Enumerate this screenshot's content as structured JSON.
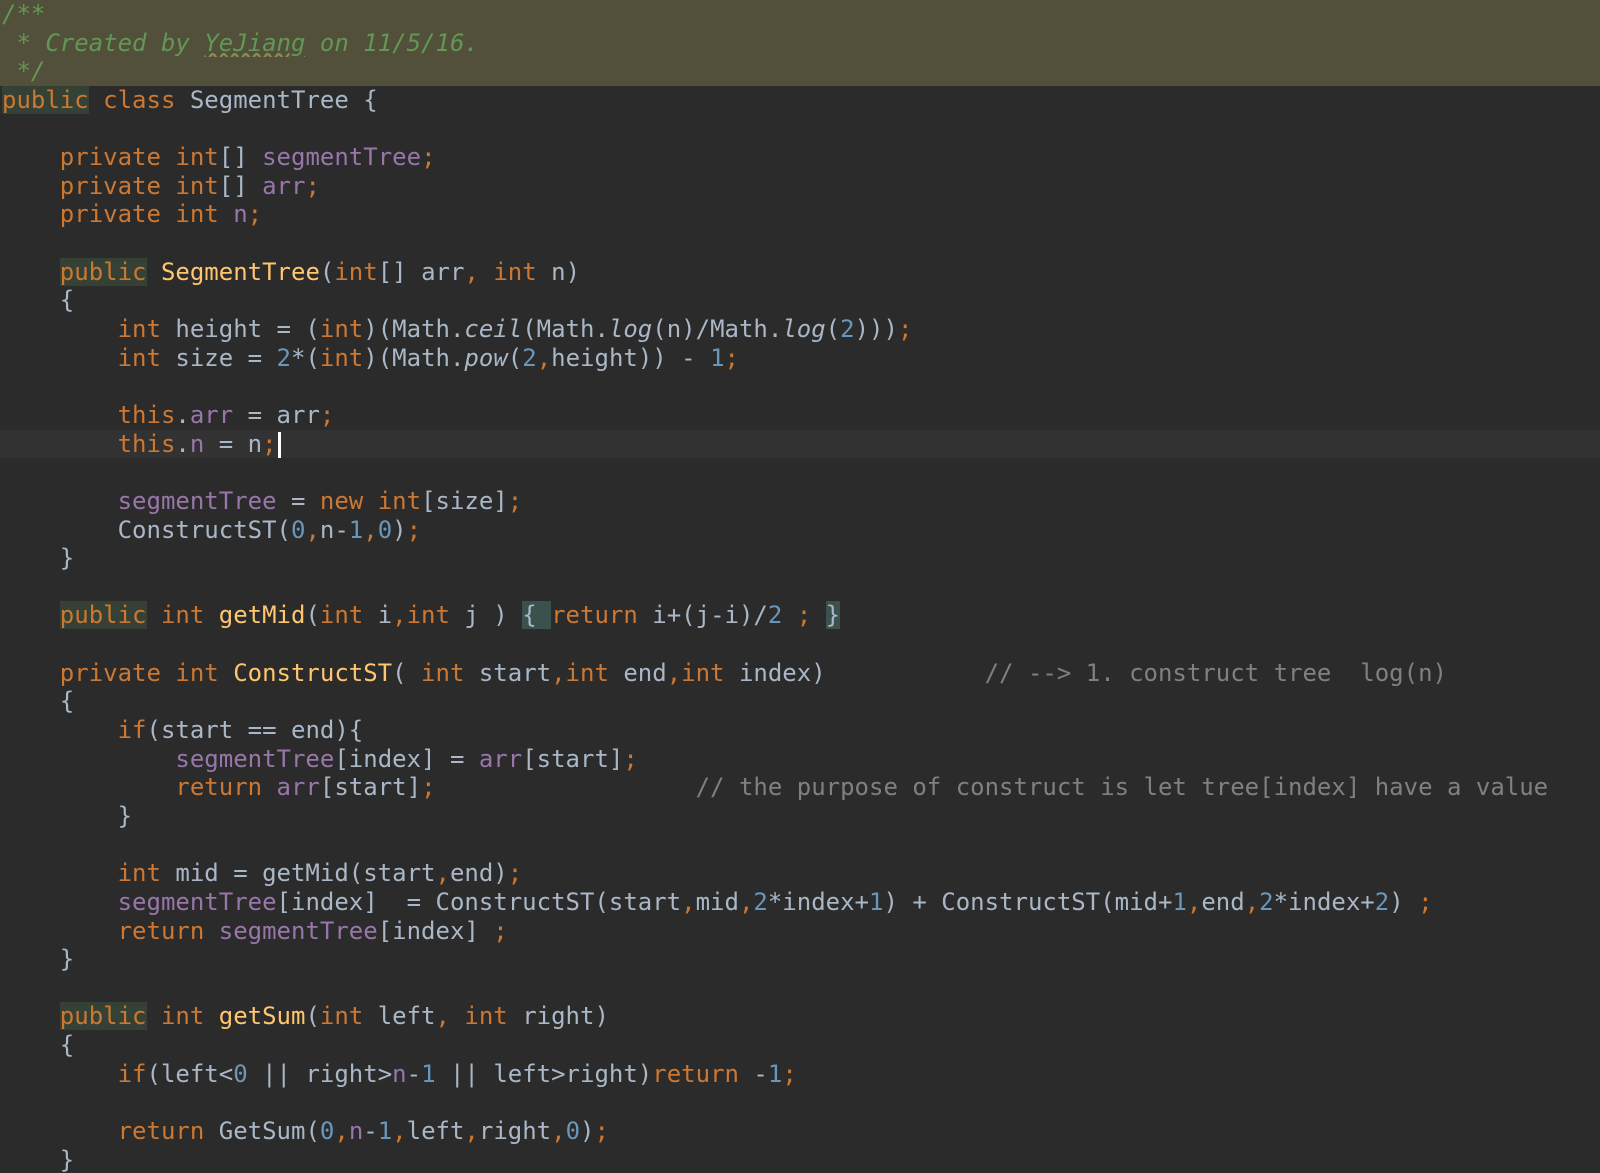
{
  "editor": {
    "file_language": "Java",
    "theme": "dark",
    "colors": {
      "background": "#2b2b2b",
      "doc_header_bg": "#52503a",
      "current_line_bg": "#323232",
      "plain": "#a9b7c6",
      "keyword": "#cc7832",
      "field": "#9876aa",
      "method": "#ffc66d",
      "number": "#6897bb",
      "comment": "#808080",
      "doc_comment": "#629755",
      "caret": "#ffffff"
    },
    "caret_line": 14
  },
  "lines": [
    {
      "class": "doc-header",
      "tokens": [
        {
          "t": "/**",
          "c": "doc_comment",
          "i": true
        }
      ]
    },
    {
      "class": "doc-header",
      "tokens": [
        {
          "t": " * Created by ",
          "c": "doc_comment",
          "i": true
        },
        {
          "t": "YeJiang",
          "c": "doc_comment",
          "i": true,
          "spell": true
        },
        {
          "t": " on 11/5/16.",
          "c": "doc_comment",
          "i": true
        }
      ]
    },
    {
      "class": "doc-header",
      "tokens": [
        {
          "t": " */",
          "c": "doc_comment",
          "i": true
        }
      ]
    },
    {
      "tokens": [
        {
          "t": "public",
          "c": "keyword",
          "usage": true
        },
        {
          "t": " class ",
          "c": "keyword"
        },
        {
          "t": "SegmentTree {",
          "c": "plain"
        }
      ]
    },
    {
      "tokens": []
    },
    {
      "tokens": [
        {
          "t": "    private ",
          "c": "keyword"
        },
        {
          "t": "int",
          "c": "keyword"
        },
        {
          "t": "[] ",
          "c": "plain"
        },
        {
          "t": "segmentTree",
          "c": "field"
        },
        {
          "t": ";",
          "c": "keyword"
        }
      ]
    },
    {
      "tokens": [
        {
          "t": "    private ",
          "c": "keyword"
        },
        {
          "t": "int",
          "c": "keyword"
        },
        {
          "t": "[] ",
          "c": "plain"
        },
        {
          "t": "arr",
          "c": "field"
        },
        {
          "t": ";",
          "c": "keyword"
        }
      ]
    },
    {
      "tokens": [
        {
          "t": "    private ",
          "c": "keyword"
        },
        {
          "t": "int ",
          "c": "keyword"
        },
        {
          "t": "n",
          "c": "field"
        },
        {
          "t": ";",
          "c": "keyword"
        }
      ]
    },
    {
      "tokens": []
    },
    {
      "tokens": [
        {
          "t": "    ",
          "c": "plain"
        },
        {
          "t": "public",
          "c": "keyword",
          "usage": true
        },
        {
          "t": " ",
          "c": "plain"
        },
        {
          "t": "SegmentTree",
          "c": "method"
        },
        {
          "t": "(",
          "c": "plain"
        },
        {
          "t": "int",
          "c": "keyword"
        },
        {
          "t": "[] arr",
          "c": "plain"
        },
        {
          "t": ", ",
          "c": "keyword"
        },
        {
          "t": "int ",
          "c": "keyword"
        },
        {
          "t": "n)",
          "c": "plain"
        }
      ]
    },
    {
      "tokens": [
        {
          "t": "    {",
          "c": "plain"
        }
      ]
    },
    {
      "tokens": [
        {
          "t": "        ",
          "c": "plain"
        },
        {
          "t": "int ",
          "c": "keyword"
        },
        {
          "t": "height = (",
          "c": "plain"
        },
        {
          "t": "int",
          "c": "keyword"
        },
        {
          "t": ")(Math.",
          "c": "plain"
        },
        {
          "t": "ceil",
          "c": "plain",
          "i": true
        },
        {
          "t": "(Math.",
          "c": "plain"
        },
        {
          "t": "log",
          "c": "plain",
          "i": true
        },
        {
          "t": "(n)/Math.",
          "c": "plain"
        },
        {
          "t": "log",
          "c": "plain",
          "i": true
        },
        {
          "t": "(",
          "c": "plain"
        },
        {
          "t": "2",
          "c": "number"
        },
        {
          "t": ")))",
          "c": "plain"
        },
        {
          "t": ";",
          "c": "keyword"
        }
      ]
    },
    {
      "tokens": [
        {
          "t": "        ",
          "c": "plain"
        },
        {
          "t": "int ",
          "c": "keyword"
        },
        {
          "t": "size = ",
          "c": "plain"
        },
        {
          "t": "2",
          "c": "number"
        },
        {
          "t": "*(",
          "c": "plain"
        },
        {
          "t": "int",
          "c": "keyword"
        },
        {
          "t": ")(Math.",
          "c": "plain"
        },
        {
          "t": "pow",
          "c": "plain",
          "i": true
        },
        {
          "t": "(",
          "c": "plain"
        },
        {
          "t": "2",
          "c": "number"
        },
        {
          "t": ",",
          "c": "keyword"
        },
        {
          "t": "height)) - ",
          "c": "plain"
        },
        {
          "t": "1",
          "c": "number"
        },
        {
          "t": ";",
          "c": "keyword"
        }
      ]
    },
    {
      "tokens": []
    },
    {
      "tokens": [
        {
          "t": "        ",
          "c": "plain"
        },
        {
          "t": "this",
          "c": "keyword"
        },
        {
          "t": ".",
          "c": "plain"
        },
        {
          "t": "arr",
          "c": "field"
        },
        {
          "t": " = arr",
          "c": "plain"
        },
        {
          "t": ";",
          "c": "keyword"
        }
      ]
    },
    {
      "class": "current-line",
      "caret": true,
      "tokens": [
        {
          "t": "        ",
          "c": "plain"
        },
        {
          "t": "this",
          "c": "keyword"
        },
        {
          "t": ".",
          "c": "plain"
        },
        {
          "t": "n",
          "c": "field"
        },
        {
          "t": " = n",
          "c": "plain"
        },
        {
          "t": ";",
          "c": "keyword"
        }
      ]
    },
    {
      "tokens": []
    },
    {
      "tokens": [
        {
          "t": "        ",
          "c": "plain"
        },
        {
          "t": "segmentTree",
          "c": "field"
        },
        {
          "t": " = ",
          "c": "plain"
        },
        {
          "t": "new ",
          "c": "keyword"
        },
        {
          "t": "int",
          "c": "keyword"
        },
        {
          "t": "[size]",
          "c": "plain"
        },
        {
          "t": ";",
          "c": "keyword"
        }
      ]
    },
    {
      "tokens": [
        {
          "t": "        ConstructST(",
          "c": "plain"
        },
        {
          "t": "0",
          "c": "number"
        },
        {
          "t": ",",
          "c": "keyword"
        },
        {
          "t": "n-",
          "c": "plain"
        },
        {
          "t": "1",
          "c": "number"
        },
        {
          "t": ",",
          "c": "keyword"
        },
        {
          "t": "0",
          "c": "number"
        },
        {
          "t": ")",
          "c": "plain"
        },
        {
          "t": ";",
          "c": "keyword"
        }
      ]
    },
    {
      "tokens": [
        {
          "t": "    }",
          "c": "plain"
        }
      ]
    },
    {
      "tokens": []
    },
    {
      "tokens": [
        {
          "t": "    ",
          "c": "plain"
        },
        {
          "t": "public",
          "c": "keyword",
          "usage": true
        },
        {
          "t": " ",
          "c": "plain"
        },
        {
          "t": "int ",
          "c": "keyword"
        },
        {
          "t": "getMid",
          "c": "method"
        },
        {
          "t": "(",
          "c": "plain"
        },
        {
          "t": "int ",
          "c": "keyword"
        },
        {
          "t": "i",
          "c": "plain"
        },
        {
          "t": ",",
          "c": "keyword"
        },
        {
          "t": "int ",
          "c": "keyword"
        },
        {
          "t": "j ) ",
          "c": "plain"
        },
        {
          "t": "{ ",
          "c": "plain",
          "brace": true
        },
        {
          "t": "return ",
          "c": "keyword"
        },
        {
          "t": "i+(j-i)/",
          "c": "plain"
        },
        {
          "t": "2",
          "c": "number"
        },
        {
          "t": " ",
          "c": "plain"
        },
        {
          "t": ";",
          "c": "keyword"
        },
        {
          "t": " ",
          "c": "plain"
        },
        {
          "t": "}",
          "c": "plain",
          "brace": true
        }
      ]
    },
    {
      "tokens": []
    },
    {
      "tokens": [
        {
          "t": "    private ",
          "c": "keyword"
        },
        {
          "t": "int ",
          "c": "keyword"
        },
        {
          "t": "ConstructST",
          "c": "method"
        },
        {
          "t": "( ",
          "c": "plain"
        },
        {
          "t": "int ",
          "c": "keyword"
        },
        {
          "t": "start",
          "c": "plain"
        },
        {
          "t": ",",
          "c": "keyword"
        },
        {
          "t": "int ",
          "c": "keyword"
        },
        {
          "t": "end",
          "c": "plain"
        },
        {
          "t": ",",
          "c": "keyword"
        },
        {
          "t": "int ",
          "c": "keyword"
        },
        {
          "t": "index)           ",
          "c": "plain"
        },
        {
          "t": "// --> 1. construct tree  log(n)",
          "c": "comment"
        }
      ]
    },
    {
      "tokens": [
        {
          "t": "    {",
          "c": "plain"
        }
      ]
    },
    {
      "tokens": [
        {
          "t": "        ",
          "c": "plain"
        },
        {
          "t": "if",
          "c": "keyword"
        },
        {
          "t": "(start == end){",
          "c": "plain"
        }
      ]
    },
    {
      "tokens": [
        {
          "t": "            ",
          "c": "plain"
        },
        {
          "t": "segmentTree",
          "c": "field"
        },
        {
          "t": "[index] = ",
          "c": "plain"
        },
        {
          "t": "arr",
          "c": "field"
        },
        {
          "t": "[start]",
          "c": "plain"
        },
        {
          "t": ";",
          "c": "keyword"
        }
      ]
    },
    {
      "tokens": [
        {
          "t": "            ",
          "c": "plain"
        },
        {
          "t": "return ",
          "c": "keyword"
        },
        {
          "t": "arr",
          "c": "field"
        },
        {
          "t": "[start]",
          "c": "plain"
        },
        {
          "t": ";",
          "c": "keyword"
        },
        {
          "t": "                  ",
          "c": "plain"
        },
        {
          "t": "// the purpose of construct is let tree[index] have a value",
          "c": "comment"
        }
      ]
    },
    {
      "tokens": [
        {
          "t": "        }",
          "c": "plain"
        }
      ]
    },
    {
      "tokens": []
    },
    {
      "tokens": [
        {
          "t": "        ",
          "c": "plain"
        },
        {
          "t": "int ",
          "c": "keyword"
        },
        {
          "t": "mid = getMid(start",
          "c": "plain"
        },
        {
          "t": ",",
          "c": "keyword"
        },
        {
          "t": "end)",
          "c": "plain"
        },
        {
          "t": ";",
          "c": "keyword"
        }
      ]
    },
    {
      "tokens": [
        {
          "t": "        ",
          "c": "plain"
        },
        {
          "t": "segmentTree",
          "c": "field"
        },
        {
          "t": "[index]  = ConstructST(start",
          "c": "plain"
        },
        {
          "t": ",",
          "c": "keyword"
        },
        {
          "t": "mid",
          "c": "plain"
        },
        {
          "t": ",",
          "c": "keyword"
        },
        {
          "t": "2",
          "c": "number"
        },
        {
          "t": "*index+",
          "c": "plain"
        },
        {
          "t": "1",
          "c": "number"
        },
        {
          "t": ") + ConstructST(mid+",
          "c": "plain"
        },
        {
          "t": "1",
          "c": "number"
        },
        {
          "t": ",",
          "c": "keyword"
        },
        {
          "t": "end",
          "c": "plain"
        },
        {
          "t": ",",
          "c": "keyword"
        },
        {
          "t": "2",
          "c": "number"
        },
        {
          "t": "*index+",
          "c": "plain"
        },
        {
          "t": "2",
          "c": "number"
        },
        {
          "t": ") ",
          "c": "plain"
        },
        {
          "t": ";",
          "c": "keyword"
        }
      ]
    },
    {
      "tokens": [
        {
          "t": "        ",
          "c": "plain"
        },
        {
          "t": "return ",
          "c": "keyword"
        },
        {
          "t": "segmentTree",
          "c": "field"
        },
        {
          "t": "[index] ",
          "c": "plain"
        },
        {
          "t": ";",
          "c": "keyword"
        }
      ]
    },
    {
      "tokens": [
        {
          "t": "    }",
          "c": "plain"
        }
      ]
    },
    {
      "tokens": []
    },
    {
      "tokens": [
        {
          "t": "    ",
          "c": "plain"
        },
        {
          "t": "public",
          "c": "keyword",
          "usage": true
        },
        {
          "t": " ",
          "c": "plain"
        },
        {
          "t": "int ",
          "c": "keyword"
        },
        {
          "t": "getSum",
          "c": "method"
        },
        {
          "t": "(",
          "c": "plain"
        },
        {
          "t": "int ",
          "c": "keyword"
        },
        {
          "t": "left",
          "c": "plain"
        },
        {
          "t": ", ",
          "c": "keyword"
        },
        {
          "t": "int ",
          "c": "keyword"
        },
        {
          "t": "right)",
          "c": "plain"
        }
      ]
    },
    {
      "tokens": [
        {
          "t": "    {",
          "c": "plain"
        }
      ]
    },
    {
      "tokens": [
        {
          "t": "        ",
          "c": "plain"
        },
        {
          "t": "if",
          "c": "keyword"
        },
        {
          "t": "(left<",
          "c": "plain"
        },
        {
          "t": "0",
          "c": "number"
        },
        {
          "t": " || right>",
          "c": "plain"
        },
        {
          "t": "n",
          "c": "field"
        },
        {
          "t": "-",
          "c": "plain"
        },
        {
          "t": "1",
          "c": "number"
        },
        {
          "t": " || left>right)",
          "c": "plain"
        },
        {
          "t": "return ",
          "c": "keyword"
        },
        {
          "t": "-",
          "c": "plain"
        },
        {
          "t": "1",
          "c": "number"
        },
        {
          "t": ";",
          "c": "keyword"
        }
      ]
    },
    {
      "tokens": []
    },
    {
      "tokens": [
        {
          "t": "        ",
          "c": "plain"
        },
        {
          "t": "return ",
          "c": "keyword"
        },
        {
          "t": "GetSum(",
          "c": "plain"
        },
        {
          "t": "0",
          "c": "number"
        },
        {
          "t": ",",
          "c": "keyword"
        },
        {
          "t": "n",
          "c": "field"
        },
        {
          "t": "-",
          "c": "plain"
        },
        {
          "t": "1",
          "c": "number"
        },
        {
          "t": ",",
          "c": "keyword"
        },
        {
          "t": "left",
          "c": "plain"
        },
        {
          "t": ",",
          "c": "keyword"
        },
        {
          "t": "right",
          "c": "plain"
        },
        {
          "t": ",",
          "c": "keyword"
        },
        {
          "t": "0",
          "c": "number"
        },
        {
          "t": ")",
          "c": "plain"
        },
        {
          "t": ";",
          "c": "keyword"
        }
      ]
    },
    {
      "tokens": [
        {
          "t": "    }",
          "c": "plain"
        }
      ]
    }
  ]
}
